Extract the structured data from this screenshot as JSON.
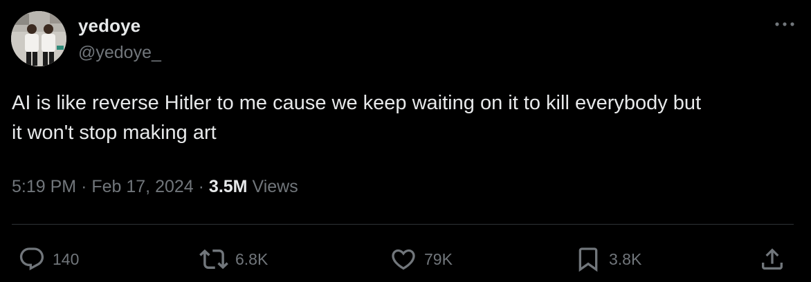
{
  "user": {
    "display_name": "yedoye",
    "handle": "@yedoye_",
    "avatar_icon": "profile-photo"
  },
  "tweet": {
    "text": "AI is like reverse Hitler to me cause we keep waiting on it to kill everybody but it won't stop making art",
    "time": "5:19 PM",
    "separator": "·",
    "date": "Feb 17, 2024",
    "views_count": "3.5M",
    "views_label": "Views"
  },
  "actions": {
    "replies": "140",
    "retweets": "6.8K",
    "likes": "79K",
    "bookmarks": "3.8K"
  },
  "icons": {
    "more": "more-horizontal-icon",
    "reply": "reply-icon",
    "retweet": "retweet-icon",
    "like": "heart-icon",
    "bookmark": "bookmark-icon",
    "share": "share-icon"
  },
  "colors": {
    "background": "#000000",
    "primary_text": "#e7e9ea",
    "secondary_text": "#71767b",
    "divider": "#2f3336"
  }
}
